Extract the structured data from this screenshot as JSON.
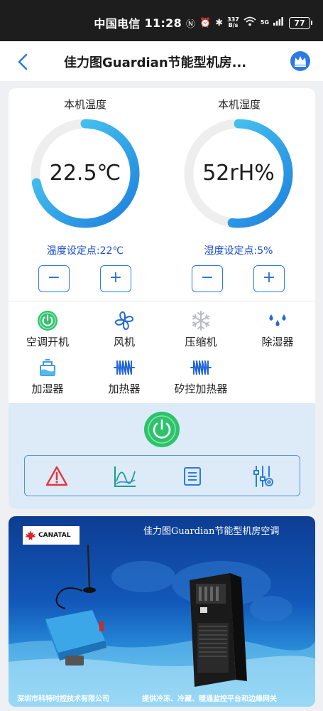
{
  "status_bar": {
    "carrier": "中国电信",
    "time": "11:28",
    "net_speed_value": "337",
    "net_speed_unit": "B/s",
    "signal_label": "5G",
    "battery": "77"
  },
  "header": {
    "title": "佳力图Guardian节能型机房..."
  },
  "gauges": {
    "temperature": {
      "title": "本机温度",
      "value": "22.5℃",
      "level": 0.72,
      "setpoint_label": "温度设定点:22℃"
    },
    "humidity": {
      "title": "本机湿度",
      "value": "52rH%",
      "level": 0.52,
      "setpoint_label": "湿度设定点:5%"
    },
    "minus_label": "−",
    "plus_label": "+"
  },
  "devices": [
    {
      "label": "空调开机",
      "icon": "power-on-icon"
    },
    {
      "label": "风机",
      "icon": "fan-icon"
    },
    {
      "label": "压缩机",
      "icon": "snowflake-icon"
    },
    {
      "label": "除湿器",
      "icon": "droplets-icon"
    },
    {
      "label": "加湿器",
      "icon": "humidifier-icon"
    },
    {
      "label": "加热器",
      "icon": "heater-icon"
    },
    {
      "label": "矽控加热器",
      "icon": "heater-icon"
    }
  ],
  "tools": [
    {
      "icon": "alarm-warning-icon"
    },
    {
      "icon": "trend-chart-icon"
    },
    {
      "icon": "list-icon"
    },
    {
      "icon": "settings-sliders-icon"
    }
  ],
  "banner": {
    "brand": "CANATAL",
    "title": "佳力图Guardian节能型机房空调",
    "footer_left": "深圳市科特时控技术有限公司",
    "footer_right": "提供冷冻、冷藏、暖通监控平台和边缘网关"
  },
  "colors": {
    "accent": "#2c7be5",
    "setpoint_text": "#1a4fd1",
    "power_green": "#2cc36b",
    "panel_bg": "#dcebf7",
    "gauge_track": "#eeeeee",
    "gauge_start": "#1e7fde",
    "gauge_end": "#4fd3f3",
    "fan_blue": "#2569d9",
    "compressor_gray": "#b9bcc1",
    "alarm_red": "#e03a3a"
  }
}
